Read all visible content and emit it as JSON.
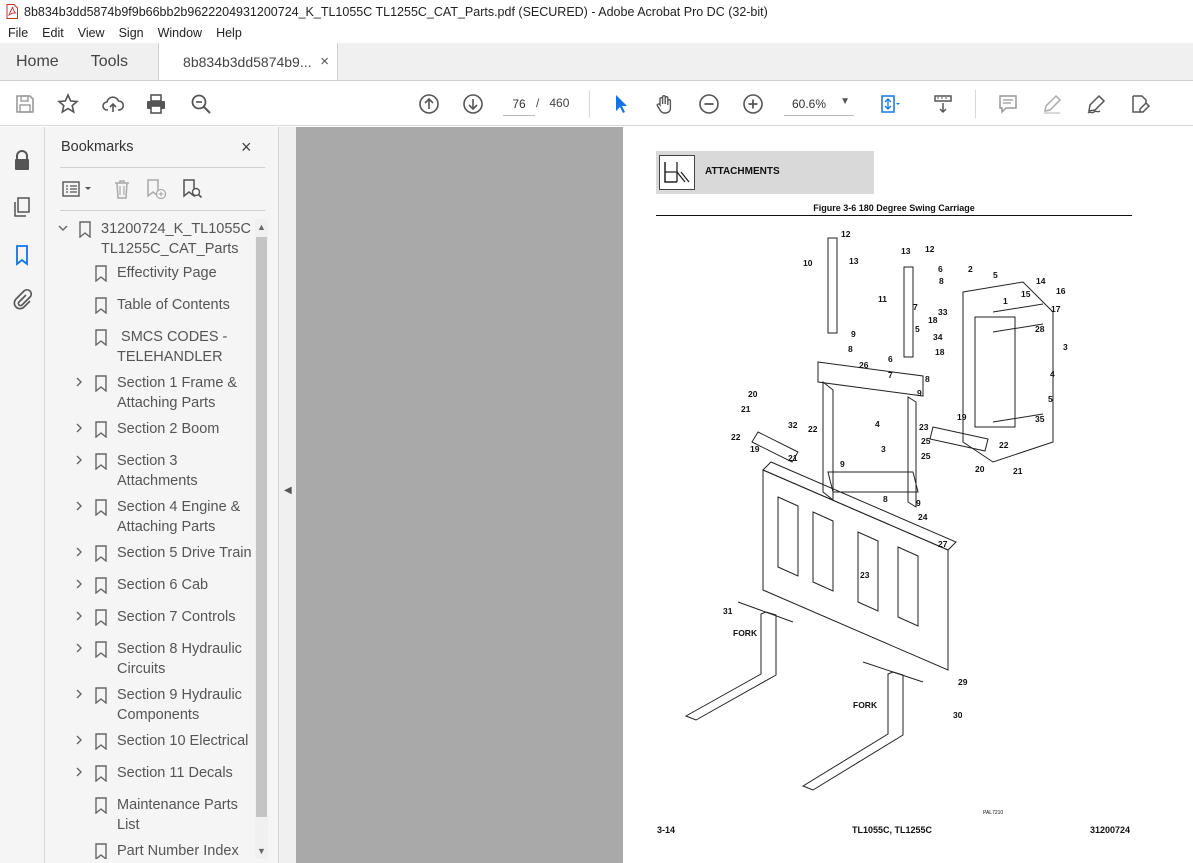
{
  "window": {
    "title": "8b834b3dd5874b9f9b66bb2b9622204931200724_K_TL1055C TL1255C_CAT_Parts.pdf (SECURED) - Adobe Acrobat Pro DC (32-bit)"
  },
  "menu": [
    "File",
    "Edit",
    "View",
    "Sign",
    "Window",
    "Help"
  ],
  "tabs": {
    "home": "Home",
    "tools": "Tools",
    "document": "8b834b3dd5874b9...",
    "close": "×"
  },
  "toolbar": {
    "current_page": "76",
    "separator": "/",
    "total_pages": "460",
    "zoom": "60.6%"
  },
  "bookmarks": {
    "title": "Bookmarks",
    "close": "×",
    "items": [
      {
        "label1": "31200724_K_TL1055C",
        "label2": "TL1255C_CAT_Parts"
      },
      {
        "label1": "Effectivity Page"
      },
      {
        "label1": "Table of Contents"
      },
      {
        "label1": " SMCS CODES -",
        "label2": "TELEHANDLER"
      },
      {
        "label1": "Section 1 Frame &",
        "label2": "Attaching Parts"
      },
      {
        "label1": "Section 2 Boom"
      },
      {
        "label1": "Section 3",
        "label2": "Attachments"
      },
      {
        "label1": "Section 4 Engine &",
        "label2": "Attaching Parts"
      },
      {
        "label1": "Section 5 Drive Train"
      },
      {
        "label1": "Section 6 Cab"
      },
      {
        "label1": "Section 7 Controls"
      },
      {
        "label1": "Section 8 Hydraulic",
        "label2": "Circuits"
      },
      {
        "label1": "Section 9 Hydraulic",
        "label2": "Components"
      },
      {
        "label1": "Section 10 Electrical"
      },
      {
        "label1": "Section 11 Decals"
      },
      {
        "label1": "Maintenance Parts",
        "label2": "List"
      },
      {
        "label1": "Part Number Index"
      }
    ]
  },
  "pdf_page": {
    "header": "ATTACHMENTS",
    "figure_title": "Figure 3-6 180 Degree Swing Carriage",
    "footer_left": "3-14",
    "footer_mid": "TL1055C, TL1255C",
    "footer_right": "31200724",
    "diagram_labels": {
      "fork": "FORK",
      "ref": "PAL7210"
    }
  }
}
